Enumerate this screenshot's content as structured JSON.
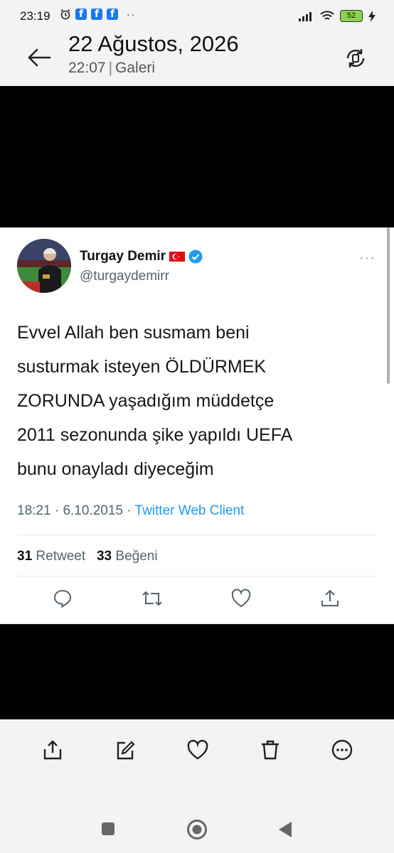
{
  "status_bar": {
    "time": "23:19",
    "battery": "52"
  },
  "header": {
    "date": "22 Ağustos, 2026",
    "time": "22:07",
    "separator": "|",
    "album": "Galeri"
  },
  "tweet": {
    "name": "Turgay Demir",
    "handle": "@turgaydemirr",
    "more": "···",
    "text": "Evvel Allah ben susmam beni\nsusturmak isteyen ÖLDÜRMEK\nZORUNDA yaşadığım müddetçe\n2011 sezonunda şike yapıldı UEFA\nbunu onayladı diyeceğim",
    "time": "18:21",
    "dot": " · ",
    "date": "6.10.2015",
    "client": "Twitter Web Client",
    "retweet_count": "31",
    "retweet_label": "Retweet",
    "like_count": "33",
    "like_label": "Beğeni"
  },
  "colors": {
    "twitter_blue": "#1d9bf0",
    "battery_green": "#8bd24a"
  },
  "icons": [
    "alarm-icon",
    "facebook-icon",
    "signal-icon",
    "wifi-icon",
    "battery-icon",
    "charging-icon",
    "back-arrow-icon",
    "rotate-icon",
    "verified-icon",
    "turkish-flag-icon",
    "reply-icon",
    "retweet-icon",
    "like-icon",
    "share-icon",
    "edit-icon",
    "delete-icon",
    "more-icon"
  ]
}
